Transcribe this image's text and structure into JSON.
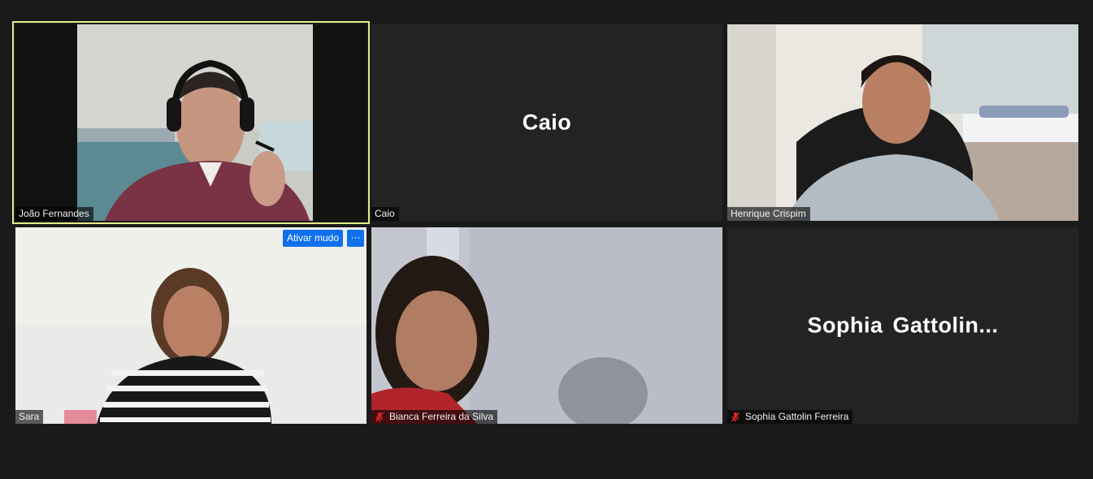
{
  "participants": [
    {
      "name": "João Fernandes"
    },
    {
      "name": "Caio",
      "display": "Caio"
    },
    {
      "name": "Henrique Crispim"
    },
    {
      "name": "Sara"
    },
    {
      "name": "Bianca Ferreira da Silva"
    },
    {
      "name": "Sophia Gattolin Ferreira",
      "display": "Sophia  Gattolin..."
    }
  ],
  "controls": {
    "unmute_label": "Ativar mudo",
    "more_label": "···"
  },
  "colors": {
    "background": "#1a1a1a",
    "tile": "#232323",
    "active_speaker_border": "#e6ee88",
    "accent": "#0e71eb",
    "muted_icon": "#e02828"
  },
  "icons": {
    "muted": "mic-muted-icon",
    "more": "more-options-icon"
  }
}
